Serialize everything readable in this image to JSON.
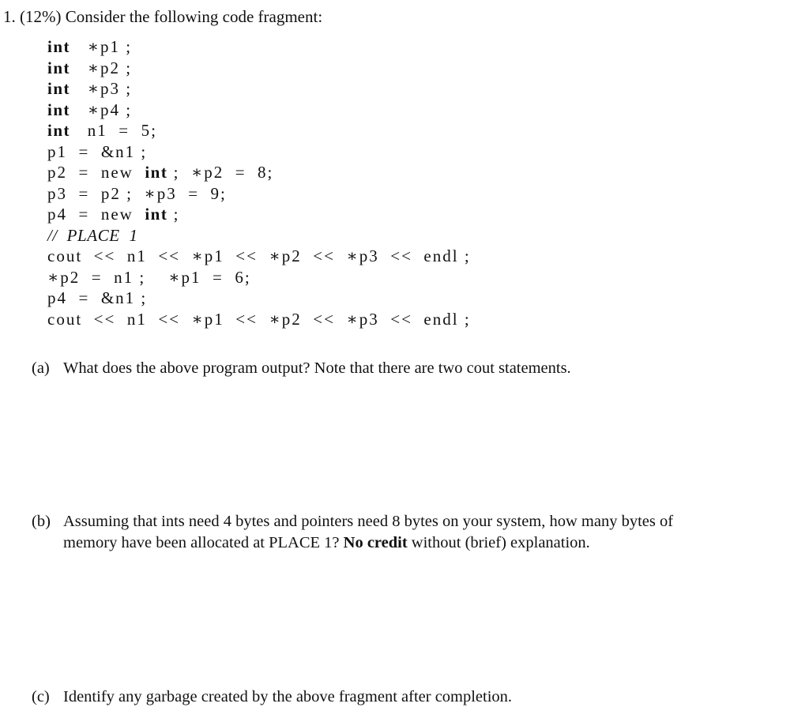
{
  "question": {
    "number": "1.",
    "weight": "(12%)",
    "prompt": "Consider the following code fragment:"
  },
  "code_lines": [
    {
      "kw": "int",
      "rest": "   ∗p1 ;"
    },
    {
      "kw": "int",
      "rest": "   ∗p2 ;"
    },
    {
      "kw": "int",
      "rest": "   ∗p3 ;"
    },
    {
      "kw": "int",
      "rest": "   ∗p4 ;"
    },
    {
      "kw": "int",
      "rest": "   n1  =  5;"
    },
    {
      "pre": "p1  =  &n1 ;"
    },
    {
      "pre": "p2  =  new  ",
      "kw": "int",
      "rest": " ;  ∗p2  =  8;"
    },
    {
      "pre": "p3  =  p2 ;  ∗p3  =  9;"
    },
    {
      "pre": "p4  =  new  ",
      "kw": "int",
      "rest": " ;"
    },
    {
      "comment": "//  PLACE  1"
    },
    {
      "pre": "cout  <<  n1  <<  ∗p1  <<  ∗p2  <<  ∗p3  <<  endl ;"
    },
    {
      "pre": "∗p2  =  n1 ;    ∗p1  =  6;"
    },
    {
      "pre": "p4  =  &n1 ;"
    },
    {
      "pre": "cout  <<  n1  <<  ∗p1  <<  ∗p2  <<  ∗p3  <<  endl ;"
    }
  ],
  "parts": {
    "a": {
      "label": "(a)",
      "text": "What does the above program output? Note that there are two cout statements."
    },
    "b": {
      "label": "(b)",
      "text_line1": "Assuming that ints need 4 bytes and pointers need 8 bytes on your system, how many bytes of",
      "text_line2_before": "memory have been allocated at PLACE 1? ",
      "text_line2_bold": "No credit",
      "text_line2_after": " without (brief) explanation."
    },
    "c": {
      "label": "(c)",
      "text": "Identify any garbage created by the above fragment after completion."
    }
  }
}
